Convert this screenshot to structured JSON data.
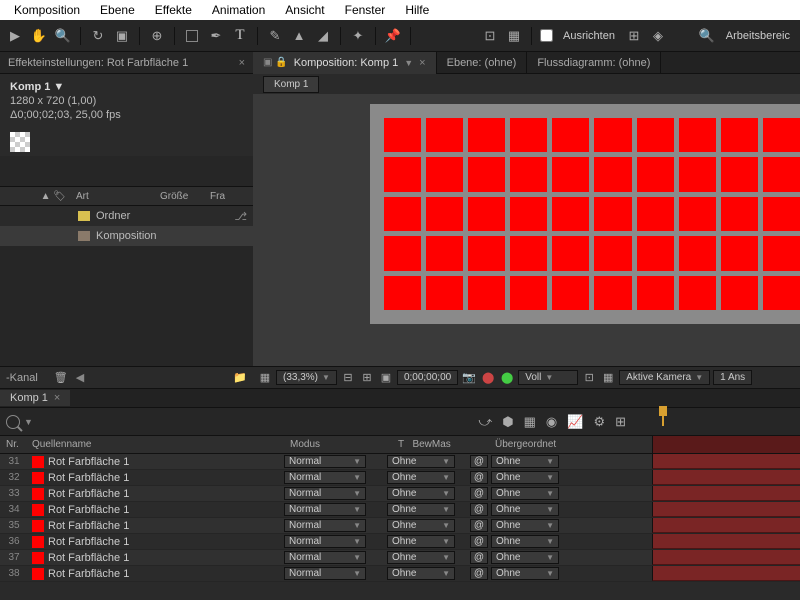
{
  "menu": [
    "Komposition",
    "Ebene",
    "Effekte",
    "Animation",
    "Ansicht",
    "Fenster",
    "Hilfe"
  ],
  "toolbar": {
    "ausrichten": "Ausrichten",
    "workspace": "Arbeitsbereic"
  },
  "fx_panel": {
    "title": "Effekteinstellungen: Rot Farbfläche 1"
  },
  "comp": {
    "name": "Komp 1 ▼",
    "dims": "1280 x 720 (1,00)",
    "dur": "Δ0;00;02;03, 25,00 fps"
  },
  "proj_head": {
    "art": "Art",
    "groesse": "Größe",
    "fra": "Fra"
  },
  "proj_items": [
    {
      "type": "folder",
      "label": "Ordner"
    },
    {
      "type": "comp",
      "label": "Komposition"
    }
  ],
  "leftfoot": {
    "kanal": "-Kanal"
  },
  "viewer_tabs": [
    {
      "label": "Komposition: Komp 1",
      "active": true
    },
    {
      "label": "Ebene: (ohne)",
      "active": false
    },
    {
      "label": "Flussdiagramm: (ohne)",
      "active": false
    }
  ],
  "viewer_subtab": "Komp 1",
  "viewer_foot": {
    "zoom": "(33,3%)",
    "time": "0;00;00;00",
    "res": "Voll",
    "cam": "Aktive Kamera",
    "views": "1 Ans"
  },
  "tl_tab": "Komp 1",
  "tl_head": {
    "nr": "Nr.",
    "name": "Quellenname",
    "mode": "Modus",
    "t": "T",
    "bew": "BewMas",
    "par": "Übergeordnet"
  },
  "layers": [
    {
      "nr": 31,
      "name": "Rot Farbfläche 1",
      "mode": "Normal",
      "bew": "Ohne",
      "par": "Ohne"
    },
    {
      "nr": 32,
      "name": "Rot Farbfläche 1",
      "mode": "Normal",
      "bew": "Ohne",
      "par": "Ohne"
    },
    {
      "nr": 33,
      "name": "Rot Farbfläche 1",
      "mode": "Normal",
      "bew": "Ohne",
      "par": "Ohne"
    },
    {
      "nr": 34,
      "name": "Rot Farbfläche 1",
      "mode": "Normal",
      "bew": "Ohne",
      "par": "Ohne"
    },
    {
      "nr": 35,
      "name": "Rot Farbfläche 1",
      "mode": "Normal",
      "bew": "Ohne",
      "par": "Ohne"
    },
    {
      "nr": 36,
      "name": "Rot Farbfläche 1",
      "mode": "Normal",
      "bew": "Ohne",
      "par": "Ohne"
    },
    {
      "nr": 37,
      "name": "Rot Farbfläche 1",
      "mode": "Normal",
      "bew": "Ohne",
      "par": "Ohne"
    },
    {
      "nr": 38,
      "name": "Rot Farbfläche 1",
      "mode": "Normal",
      "bew": "Ohne",
      "par": "Ohne"
    }
  ]
}
